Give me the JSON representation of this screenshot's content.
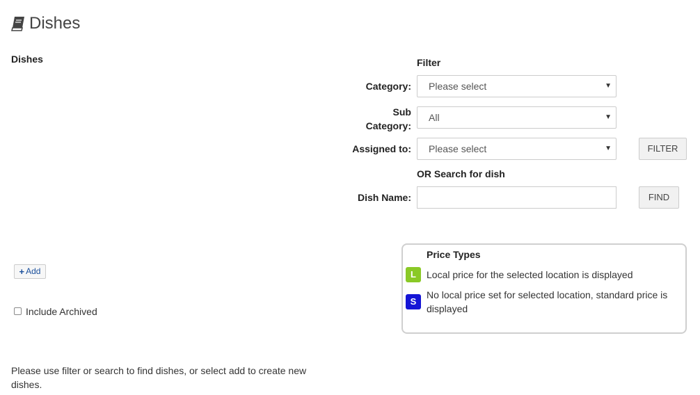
{
  "header": {
    "title": "Dishes",
    "icon": "book-icon"
  },
  "section": {
    "label": "Dishes"
  },
  "filter": {
    "heading": "Filter",
    "category_label": "Category:",
    "category_value": "Please select",
    "subcategory_label_1": "Sub",
    "subcategory_label_2": "Category:",
    "subcategory_value": "All",
    "assigned_label": "Assigned to:",
    "assigned_value": "Please select",
    "filter_button": "FILTER"
  },
  "search": {
    "heading": "OR Search for dish",
    "dish_name_label": "Dish Name:",
    "dish_name_value": "",
    "find_button": "FIND"
  },
  "actions": {
    "add_label": "Add",
    "include_archived_label": "Include Archived",
    "include_archived_checked": false
  },
  "price_types": {
    "heading": "Price Types",
    "local": {
      "badge": "L",
      "text": "Local price for the selected location is displayed",
      "color": "#8ac926"
    },
    "standard": {
      "badge": "S",
      "text": "No local price set for selected location, standard price is displayed",
      "color": "#1515d6"
    }
  },
  "message": "Please use filter or search to find dishes, or select add to create new dishes."
}
